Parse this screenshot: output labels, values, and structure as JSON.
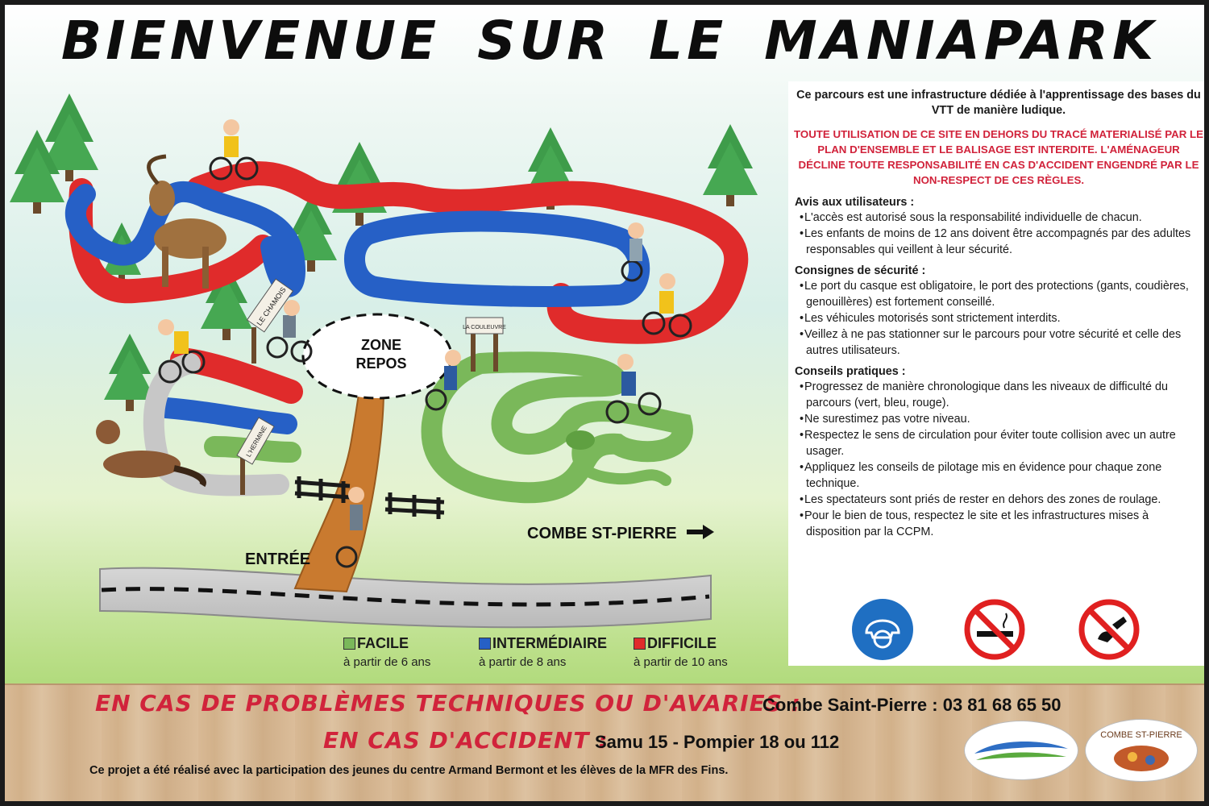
{
  "title": "BIENVENUE SUR LE MANIAPARK",
  "map": {
    "rest_zone_line1": "ZONE",
    "rest_zone_line2": "REPOS",
    "entrance": "ENTRÉE",
    "direction": "COMBE ST-PIERRE",
    "sign_left": "LE CHAMOIS",
    "sign_right": "LA COULEUVRE",
    "sign_bottom": "L'HERMINE"
  },
  "legend": [
    {
      "label": "FACILE",
      "sub": "à partir de 6 ans",
      "color": "#7ab85a"
    },
    {
      "label": "INTERMÉDIAIRE",
      "sub": "à partir de 8 ans",
      "color": "#2660c6"
    },
    {
      "label": "DIFFICILE",
      "sub": "à partir de 10 ans",
      "color": "#e02b2b"
    }
  ],
  "panel": {
    "intro": "Ce parcours est une infrastructure dédiée à l'apprentissage des bases du VTT de manière ludique.",
    "warning": "TOUTE UTILISATION DE CE SITE EN DEHORS DU TRACÉ MATERIALISÉ PAR LE PLAN D'ENSEMBLE ET LE BALISAGE EST INTERDITE. L'AMÉNAGEUR DÉCLINE TOUTE RESPONSABILITÉ EN CAS D'ACCIDENT ENGENDRÉ PAR LE NON-RESPECT DE CES RÈGLES.",
    "sections": [
      {
        "heading": "Avis aux utilisateurs :",
        "items": [
          "L'accès est autorisé sous la responsabilité individuelle de chacun.",
          "Les enfants de moins de 12 ans doivent être accompagnés par des adultes responsables qui veillent à leur sécurité."
        ]
      },
      {
        "heading": "Consignes de sécurité :",
        "items": [
          "Le port du casque est obligatoire, le port des protections (gants, coudières, genouillères) est fortement conseillé.",
          "Les véhicules motorisés sont strictement interdits.",
          "Veillez à ne pas stationner sur le parcours pour votre sécurité et celle des autres utilisateurs."
        ]
      },
      {
        "heading": "Conseils pratiques :",
        "items": [
          "Progressez de manière chronologique dans les niveaux de difficulté du parcours (vert, bleu, rouge).",
          "Ne surestimez pas votre niveau.",
          "Respectez le sens de circulation pour éviter toute collision avec un autre usager.",
          "Appliquez les conseils de pilotage mis en évidence pour chaque zone technique.",
          "Les spectateurs sont priés de rester en dehors des zones de roulage.",
          "Pour le bien de tous, respectez le site et les infrastructures mises à disposition par la CCPM."
        ]
      }
    ],
    "icons": [
      "helmet-mandatory-icon",
      "no-smoking-icon",
      "no-littering-icon"
    ]
  },
  "footer": {
    "technical_label": "EN CAS DE PROBLÈMES TECHNIQUES OU D'AVARIES :",
    "technical_contact": "Combe Saint-Pierre : 03 81 68 65 50",
    "accident_label": "EN CAS D'ACCIDENT :",
    "accident_contact": "Samu 15 - Pompier 18 ou 112",
    "credit": "Ce projet a été réalisé avec la participation des jeunes du centre Armand Bermont et les élèves de la MFR des Fins.",
    "logo_right_text": "COMBE ST-PIERRE"
  },
  "colors": {
    "red": "#e02b2b",
    "blue": "#2660c6",
    "green": "#7ab85a",
    "warning": "#d1233b",
    "path": "#c97a2f"
  }
}
